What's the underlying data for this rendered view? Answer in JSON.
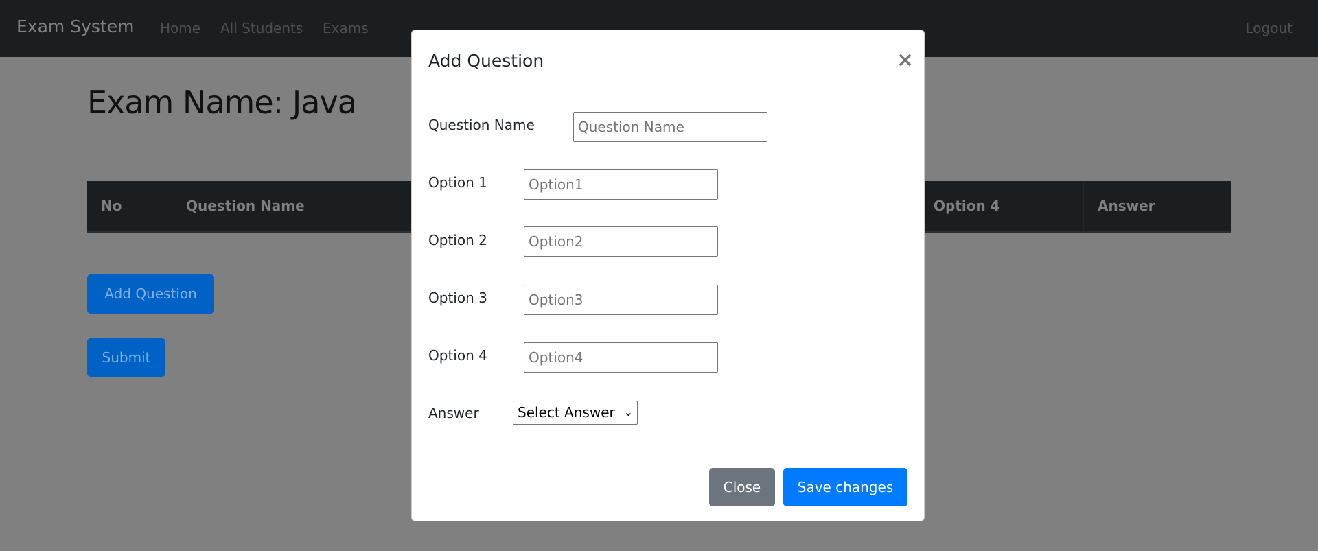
{
  "navbar": {
    "brand": "Exam System",
    "links": [
      "Home",
      "All Students",
      "Exams"
    ],
    "logout": "Logout"
  },
  "page": {
    "heading": "Exam Name: Java",
    "table_headers": [
      "No",
      "Question Name",
      "Option 4",
      "Answer"
    ],
    "add_question_label": "Add Question",
    "submit_label": "Submit"
  },
  "modal": {
    "title": "Add Question",
    "close_icon": "×",
    "fields": [
      {
        "label": "Question Name",
        "placeholder": "Question Name",
        "value": ""
      },
      {
        "label": "Option 1",
        "placeholder": "Option1",
        "value": ""
      },
      {
        "label": "Option 2",
        "placeholder": "Option2",
        "value": ""
      },
      {
        "label": "Option 3",
        "placeholder": "Option3",
        "value": ""
      },
      {
        "label": "Option 4",
        "placeholder": "Option4",
        "value": ""
      }
    ],
    "answer_label": "Answer",
    "answer_selected": "Select Answer",
    "close_label": "Close",
    "save_label": "Save changes"
  },
  "colors": {
    "primary": "#007bff",
    "secondary": "#6c757d",
    "navbar": "#343a40",
    "backdrop": "rgba(0,0,0,0.5)"
  }
}
